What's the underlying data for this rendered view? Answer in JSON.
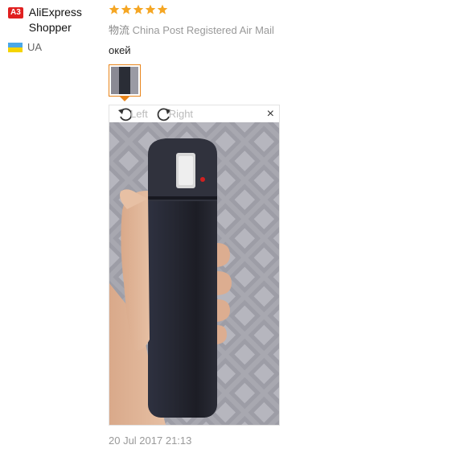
{
  "user": {
    "badge": "A3",
    "name": "AliExpress Shopper",
    "country_code": "UA",
    "flag_colors": [
      "#4aa8e8",
      "#f5d400"
    ]
  },
  "review": {
    "rating": 5,
    "star_color": "#f5a623",
    "logistics_prefix": "物流",
    "logistics": "China Post Registered Air Mail",
    "text": "окей",
    "date": "20 Jul 2017 21:13"
  },
  "viewer": {
    "rotate_left": "Left",
    "rotate_right": "Right",
    "close": "×",
    "accent": "#e8841a"
  }
}
